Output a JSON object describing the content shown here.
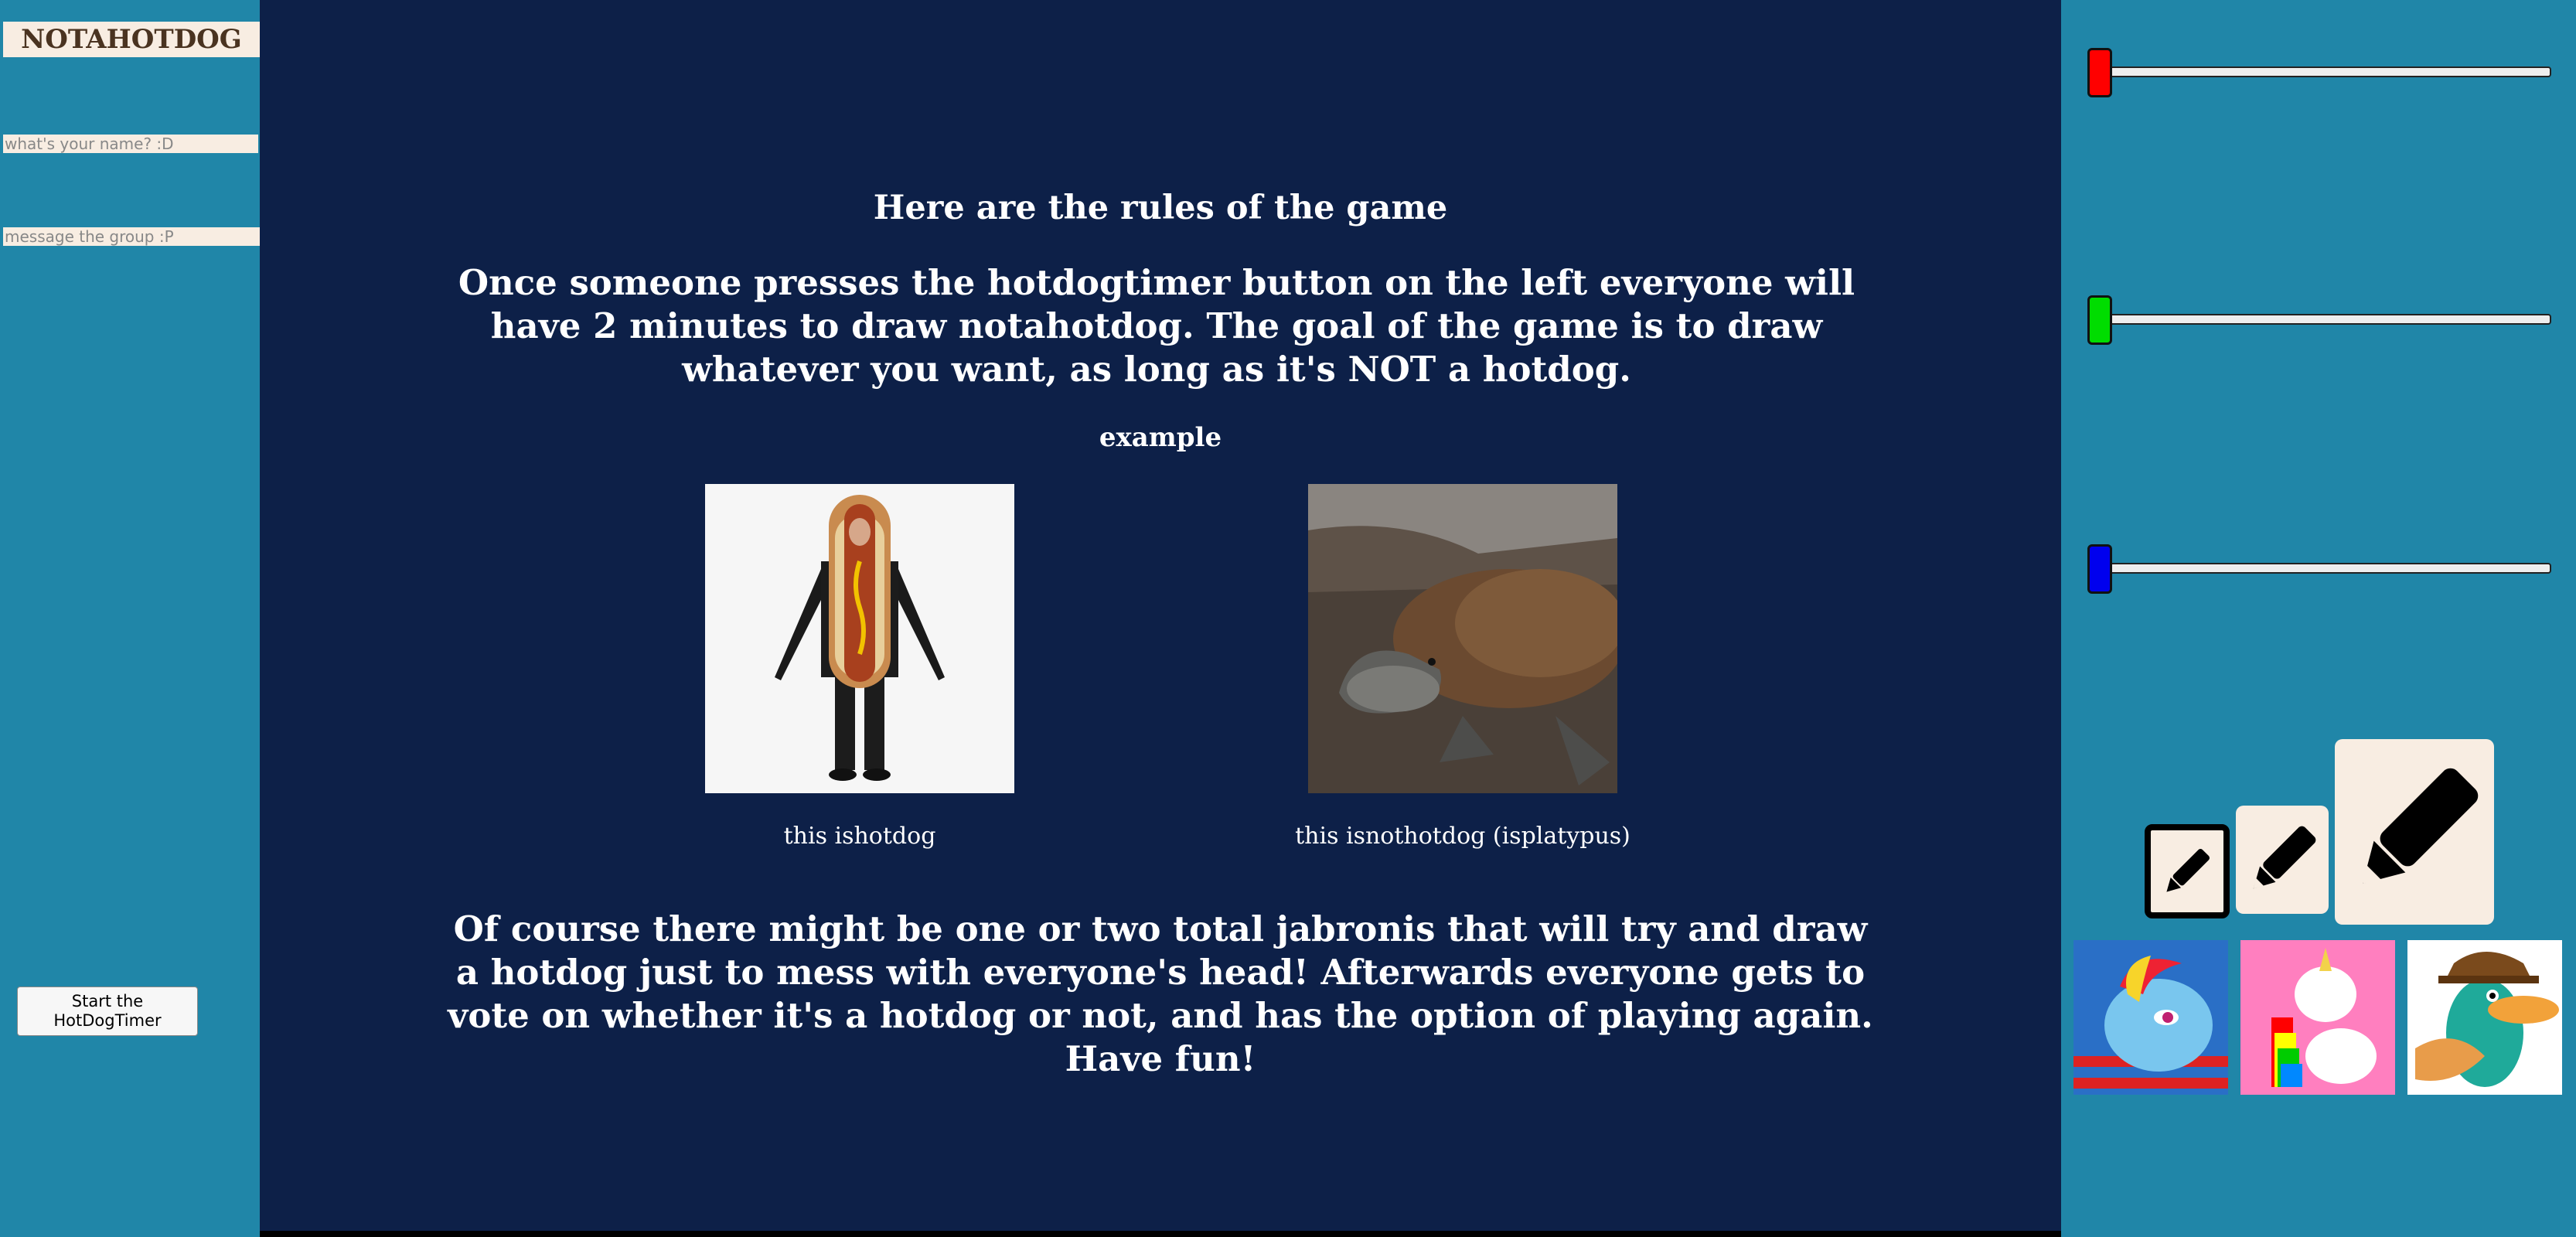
{
  "sidebar": {
    "logo": "NOTAHOTDOG",
    "name_placeholder": "what's your name? :D",
    "message_placeholder": "message the group :P",
    "timer_button": "Start the HotDogTimer"
  },
  "main": {
    "rules_title": "Here are the rules of the game",
    "rules_body": "Once someone presses the hotdogtimer button on the left everyone will have 2 minutes to draw notahotdog. The goal of the game is to draw whatever you want, as long as it's NOT a hotdog.",
    "example_label": "example",
    "examples": [
      {
        "caption": "this ishotdog"
      },
      {
        "caption": "this isnothotdog (isplatypus)"
      }
    ],
    "closing": "Of course there might be one or two total jabronis that will try and draw a hotdog just to mess with everyone's head! Afterwards everyone gets to vote on whether it's a hotdog or not, and has the option of playing again. Have fun!"
  },
  "toolbar": {
    "sliders": [
      {
        "color": "#ff0000",
        "value": 0
      },
      {
        "color": "#00dd00",
        "value": 0
      },
      {
        "color": "#0000ee",
        "value": 0
      }
    ],
    "pencil_sizes": [
      "small",
      "medium",
      "large"
    ],
    "stickers": [
      "rainbow-dash-pony",
      "rainbow-unicorn",
      "perry-the-platypus"
    ]
  }
}
